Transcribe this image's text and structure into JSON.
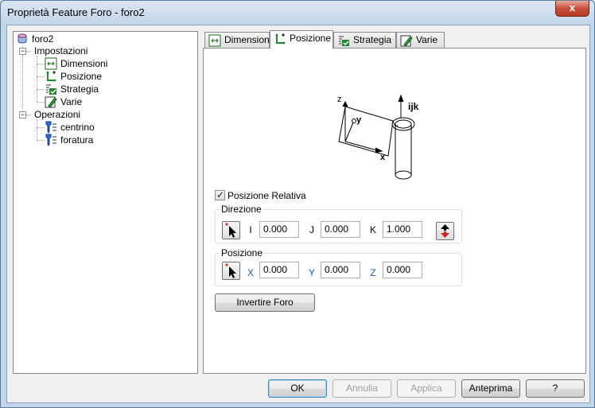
{
  "window": {
    "title": "Proprietà Feature Foro - foro2",
    "close_label": "x"
  },
  "tree": {
    "root": {
      "label": "foro2",
      "icon": "cylinder-feature-icon"
    },
    "groups": [
      {
        "label": "Impostazioni",
        "expander": "−",
        "items": [
          {
            "label": "Dimensioni",
            "icon": "dimensions-icon"
          },
          {
            "label": "Posizione",
            "icon": "position-icon"
          },
          {
            "label": "Strategia",
            "icon": "strategy-icon"
          },
          {
            "label": "Varie",
            "icon": "misc-icon"
          }
        ]
      },
      {
        "label": "Operazioni",
        "expander": "−",
        "items": [
          {
            "label": "centrino",
            "icon": "drill-op-icon"
          },
          {
            "label": "foratura",
            "icon": "drill-op-icon"
          }
        ]
      }
    ]
  },
  "tabs": [
    {
      "label": "Dimensioni",
      "icon": "dimensions-icon",
      "active": false
    },
    {
      "label": "Posizione",
      "icon": "position-icon",
      "active": true
    },
    {
      "label": "Strategia",
      "icon": "strategy-icon",
      "active": false
    },
    {
      "label": "Varie",
      "icon": "misc-icon",
      "active": false
    }
  ],
  "diagram": {
    "labels": {
      "z": "z",
      "y": "y",
      "x": "x",
      "ijk": "ijk"
    }
  },
  "relative": {
    "label": "Posizione Relativa",
    "checked": true,
    "check_glyph": "✓"
  },
  "direction": {
    "title": "Direzione",
    "fields": [
      {
        "axis": "I",
        "value": "0.000"
      },
      {
        "axis": "J",
        "value": "0.000"
      },
      {
        "axis": "K",
        "value": "1.000"
      }
    ]
  },
  "position": {
    "title": "Posizione",
    "fields": [
      {
        "axis": "X",
        "value": "0.000"
      },
      {
        "axis": "Y",
        "value": "0.000"
      },
      {
        "axis": "Z",
        "value": "0.000"
      }
    ]
  },
  "invert_button": "Invertire Foro",
  "footer": {
    "ok": "OK",
    "cancel": "Annulla",
    "apply": "Applica",
    "preview": "Anteprima",
    "help": "?"
  },
  "colors": {
    "axis_blue": "#1a5fb4",
    "accent_green": "#1f8a2e",
    "flip_red": "#d02020"
  }
}
